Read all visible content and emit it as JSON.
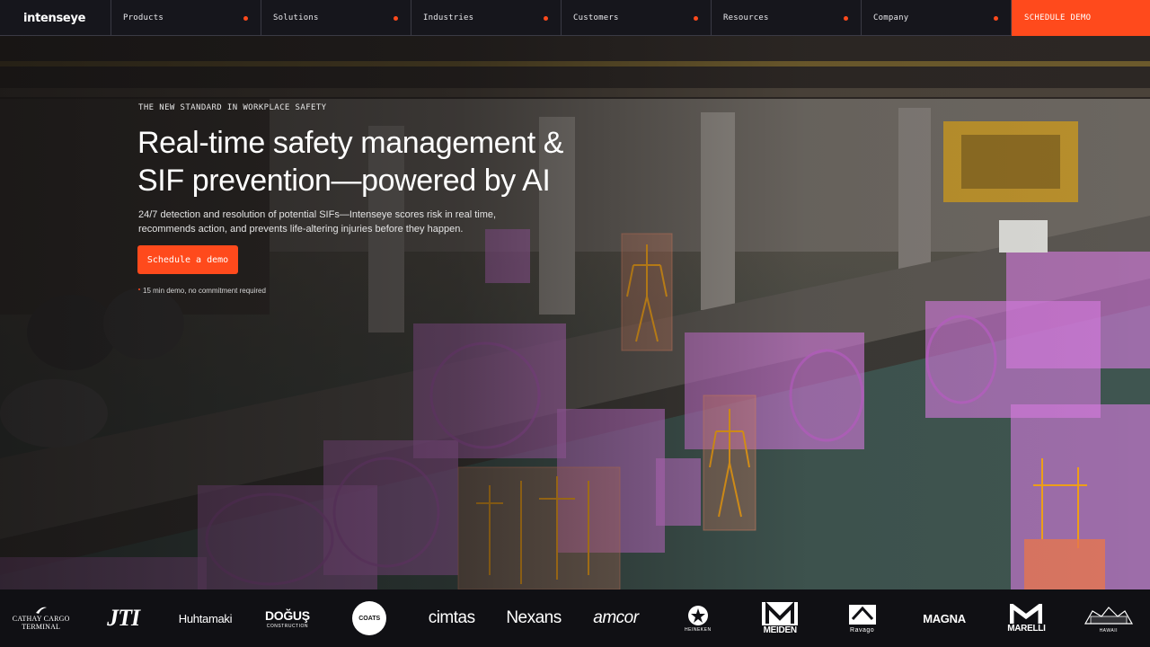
{
  "brand": {
    "name": "intenseye"
  },
  "nav": {
    "items": [
      {
        "label": "Products"
      },
      {
        "label": "Solutions"
      },
      {
        "label": "Industries"
      },
      {
        "label": "Customers"
      },
      {
        "label": "Resources"
      },
      {
        "label": "Company"
      }
    ],
    "cta_label": "SCHEDULE DEMO"
  },
  "hero": {
    "eyebrow": "THE NEW STANDARD IN WORKPLACE SAFETY",
    "headline_line1": "Real-time safety management &",
    "headline_line2": "SIF prevention—powered by AI",
    "subtext": "24/7 detection and resolution of potential SIFs—Intenseye scores risk in real time, recommends action, and prevents life-altering injuries before they happen.",
    "cta_label": "Schedule a demo",
    "note": "15 min demo, no commitment required"
  },
  "clients": {
    "cathay_line1": "CATHAY CARGO",
    "cathay_line2": "TERMINAL",
    "jti": "JTI",
    "huhtamaki": "Huhtamaki",
    "dogus": "DOĞUŞ",
    "dogus_sub": "CONSTRUCTION",
    "coats": "COATS",
    "cimtas": "cimtas",
    "nexans": "Nexans",
    "amcor": "amcor",
    "heineken": "HEINEKEN",
    "meiden": "MEIDEN",
    "ravago": "Ravago",
    "magna": "MAGNA",
    "marelli": "MARELLI",
    "hawaii": "HAWAII"
  },
  "colors": {
    "accent": "#ff4a1c",
    "nav_bg": "#16161c",
    "detection_box": "#d77ce0",
    "skeleton": "#f0a018"
  }
}
